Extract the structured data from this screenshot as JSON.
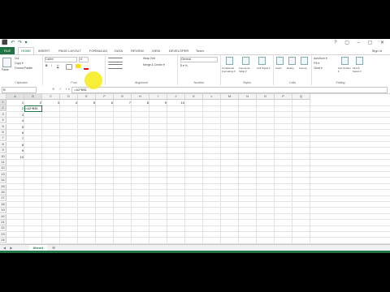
{
  "qat": "⬛ ↶ ↷ ▾",
  "window_controls": "? ▢ – ▢ ✕",
  "tabs": [
    {
      "label": "FILE",
      "kind": "file"
    },
    {
      "label": "HOME",
      "kind": "active"
    },
    {
      "label": "INSERT",
      "kind": ""
    },
    {
      "label": "PAGE LAYOUT",
      "kind": ""
    },
    {
      "label": "FORMULAS",
      "kind": ""
    },
    {
      "label": "DATA",
      "kind": ""
    },
    {
      "label": "REVIEW",
      "kind": ""
    },
    {
      "label": "VIEW",
      "kind": ""
    },
    {
      "label": "DEVELOPER",
      "kind": ""
    },
    {
      "label": "Team",
      "kind": ""
    }
  ],
  "signin": "Sign in",
  "ribbon": {
    "clipboard": {
      "label": "Clipboard",
      "paste": "Paste",
      "cut": "Cut",
      "copy": "Copy ▾",
      "format_painter": "Format Painter"
    },
    "font": {
      "label": "Font",
      "font_name": "Calibri",
      "font_size": "11",
      "bold": "B",
      "italic": "I",
      "underline": "U"
    },
    "alignment": {
      "label": "Alignment",
      "wrap": "Wrap Text",
      "merge": "Merge & Center ▾"
    },
    "number": {
      "label": "Number",
      "format": "General",
      "symbols": "$ ▾  %  ,"
    },
    "styles": {
      "label": "Styles",
      "conditional": "Conditional Formatting ▾",
      "format_table": "Format as Table ▾",
      "cell_styles": "Cell Styles ▾"
    },
    "cells": {
      "label": "Cells",
      "insert": "Insert",
      "delete": "Delete",
      "format": "Format"
    },
    "editing": {
      "label": "Editing",
      "autosum": "AutoSum ▾",
      "fill": "Fill ▾",
      "clear": "Clear ▾",
      "sort": "Sort & Filter ▾",
      "find": "Find & Select ▾"
    }
  },
  "formula_bar": {
    "name_box": "B",
    "fx": "✕ ✓ fx",
    "value": "=A2*B$1"
  },
  "columns": [
    "A",
    "B",
    "C",
    "D",
    "E",
    "F",
    "G",
    "H",
    "I",
    "J",
    "K",
    "L",
    "M",
    "N",
    "O",
    "P",
    "Q"
  ],
  "rows": [
    "1",
    "2",
    "3",
    "4",
    "5",
    "6",
    "7",
    "8",
    "9",
    "10",
    "11",
    "12",
    "13",
    "14",
    "15",
    "16",
    "17",
    "18",
    "19",
    "20",
    "21",
    "22",
    "23",
    "24"
  ],
  "cells": {
    "a1": "1",
    "b1": "2",
    "c1": "3",
    "d1": "4",
    "e1": "5",
    "f1": "6",
    "g1": "7",
    "h1": "8",
    "i1": "9",
    "j1": "10",
    "a2": "2",
    "b2": "=A2*B$1",
    "a3": "3",
    "a4": "4",
    "a5": "5",
    "a6": "6",
    "a7": "7",
    "a8": "8",
    "a9": "9",
    "a10": "10"
  },
  "sheet_tab": "Sheet1",
  "nav_arrows": "◀ ▶",
  "add_sheet": "⊕",
  "status": "EDIT"
}
